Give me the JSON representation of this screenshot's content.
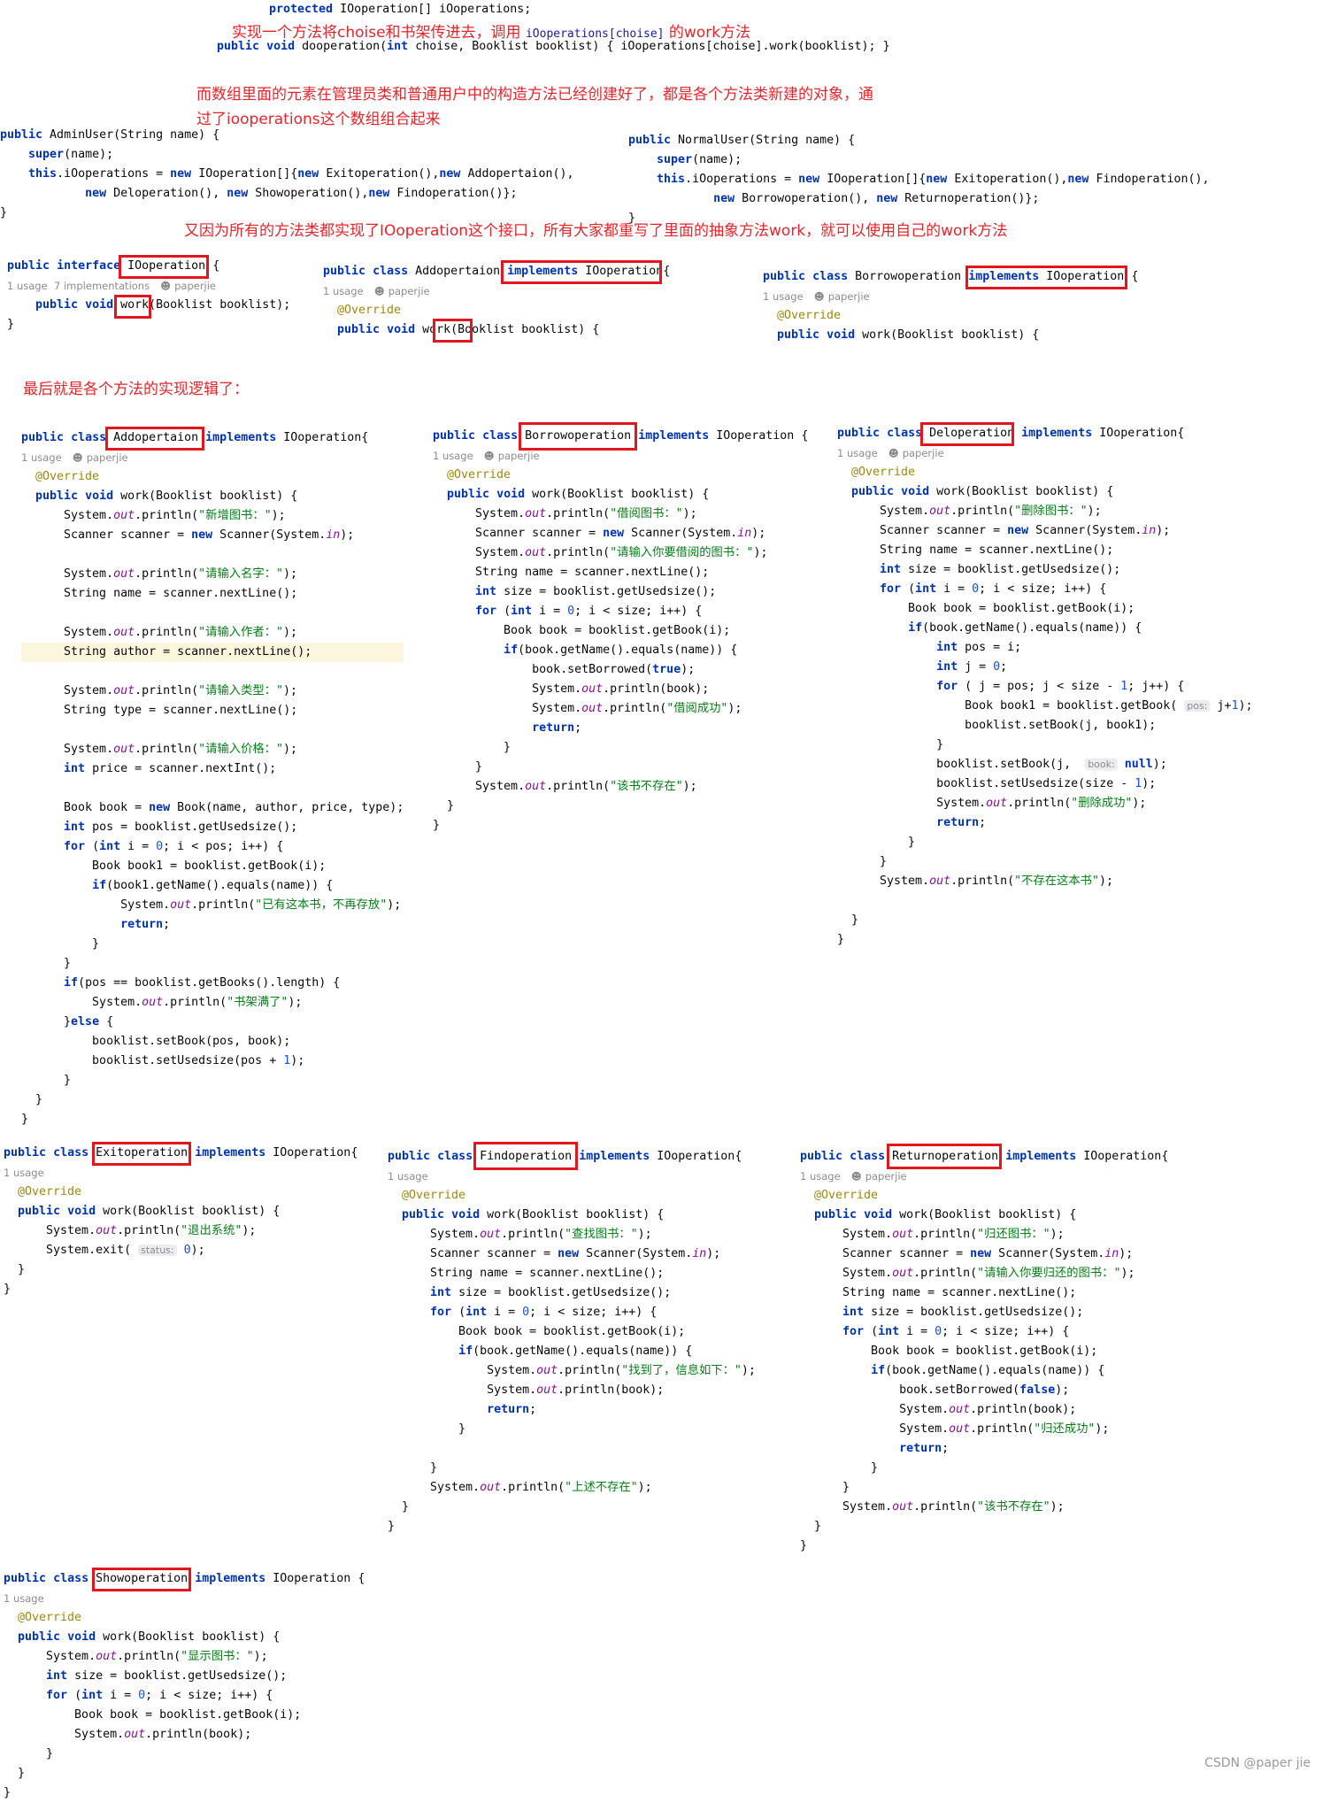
{
  "annotations": {
    "a1_pre": "实现一个方法将choise和书架传进去，调用 ",
    "a1_code": "iOoperations[choise]",
    "a1_post": " 的work方法",
    "a2_line1": "而数组里面的元素在管理员类和普通用户中的构造方法已经创建好了，都是各个方法类新建的对象，通",
    "a2_line2": "过了iooperations这个数组组合起来",
    "a3": "又因为所有的方法类都实现了IOoperation这个接口，所有大家都重写了里面的抽象方法work，就可以使用自己的work方法",
    "a4": "最后就是各个方法的实现逻辑了："
  },
  "hints": {
    "usage": "1 usage",
    "impls": "7 implementations",
    "author": "paperjie"
  },
  "param_hints": {
    "pos": "pos:",
    "book": "book:",
    "status": "status:"
  },
  "watermark": "CSDN @paper jie",
  "colors": {
    "annotation": "#e5242b",
    "highlight_box": "#e2161e",
    "keyword": "#0033b3",
    "string": "#067d17",
    "number": "#1750eb",
    "field": "#871094",
    "annotation_tag": "#9e880d"
  },
  "snippets": {
    "top_field": [
      "protected IOoperation[] iOoperations;"
    ],
    "top_method": [
      "public void dooperation(int choise, Booklist booklist) { iOoperations[choise].work(booklist); }"
    ],
    "admin": [
      "public AdminUser(String name) {",
      "    super(name);",
      "    this.iOoperations = new IOoperation[]{new Exitoperation(),new Addopertaion(),",
      "            new Deloperation(), new Showoperation(),new Findoperation()};",
      "}"
    ],
    "normal": [
      "public NormalUser(String name) {",
      "    super(name);",
      "    this.iOoperations = new IOoperation[]{new Exitoperation(),new Findoperation(),",
      "            new Borrowoperation(), new Returnoperation()};",
      "}"
    ],
    "iface": [
      "public interface IOoperation {",
      "  {{hint_impl}}",
      "    public void work(Booklist booklist);",
      "}"
    ],
    "addp_head": [
      "public class Addopertaion implements IOoperation{",
      "  {{hint}}",
      "  @Override",
      "  public void work(Booklist booklist) {"
    ],
    "borrow_head": [
      "public class Borrowoperation implements IOoperation {",
      "  {{hint}}",
      "  @Override",
      "  public void work(Booklist booklist) {"
    ],
    "add": [
      "public class Addopertaion implements IOoperation{",
      "  {{hint}}",
      "  @Override",
      "  public void work(Booklist booklist) {",
      "      System.out.println(\"新增图书：\");",
      "      Scanner scanner = new Scanner(System.in);",
      "",
      "      System.out.println(\"请输入名字：\");",
      "      String name = scanner.nextLine();",
      "",
      "      System.out.println(\"请输入作者：\");",
      "      String author = scanner.nextLine();",
      "",
      "      System.out.println(\"请输入类型：\");",
      "      String type = scanner.nextLine();",
      "",
      "      System.out.println(\"请输入价格：\");",
      "      int price = scanner.nextInt();",
      "",
      "      Book book = new Book(name, author, price, type);",
      "      int pos = booklist.getUsedsize();",
      "      for (int i = 0; i < pos; i++) {",
      "          Book book1 = booklist.getBook(i);",
      "          if(book1.getName().equals(name)) {",
      "              System.out.println(\"已有这本书，不再存放\");",
      "              return;",
      "          }",
      "      }",
      "      if(pos == booklist.getBooks().length) {",
      "          System.out.println(\"书架满了\");",
      "      }else {",
      "          booklist.setBook(pos, book);",
      "          booklist.setUsedsize(pos + 1);",
      "      }",
      "  }",
      "}"
    ],
    "borrow": [
      "public class Borrowoperation implements IOoperation {",
      "  {{hint}}",
      "  @Override",
      "  public void work(Booklist booklist) {",
      "      System.out.println(\"借阅图书：\");",
      "      Scanner scanner = new Scanner(System.in);",
      "      System.out.println(\"请输入你要借阅的图书：\");",
      "      String name = scanner.nextLine();",
      "      int size = booklist.getUsedsize();",
      "      for (int i = 0; i < size; i++) {",
      "          Book book = booklist.getBook(i);",
      "          if(book.getName().equals(name)) {",
      "              book.setBorrowed(true);",
      "              System.out.println(book);",
      "              System.out.println(\"借阅成功\");",
      "              return;",
      "          }",
      "      }",
      "      System.out.println(\"该书不存在\");",
      "  }",
      "}"
    ],
    "del": [
      "public class Deloperation implements IOoperation{",
      "  {{hint}}",
      "  @Override",
      "  public void work(Booklist booklist) {",
      "      System.out.println(\"删除图书：\");",
      "      Scanner scanner = new Scanner(System.in);",
      "      String name = scanner.nextLine();",
      "      int size = booklist.getUsedsize();",
      "      for (int i = 0; i < size; i++) {",
      "          Book book = booklist.getBook(i);",
      "          if(book.getName().equals(name)) {",
      "              int pos = i;",
      "              int j = 0;",
      "              for ( j = pos; j < size - 1; j++) {",
      "                  Book book1 = booklist.getBook( {{pos}} j+1);",
      "                  booklist.setBook(j, book1);",
      "              }",
      "              booklist.setBook(j,  {{book}} null);",
      "              booklist.setUsedsize(size - 1);",
      "              System.out.println(\"删除成功\");",
      "              return;",
      "          }",
      "      }",
      "      System.out.println(\"不存在这本书\");",
      "",
      "  }",
      "}"
    ],
    "exit": [
      "public class Exitoperation implements IOoperation{",
      "  {{usage_only}}",
      "  @Override",
      "  public void work(Booklist booklist) {",
      "      System.out.println(\"退出系统\");",
      "      System.exit( {{status}} 0);",
      "  }",
      "}"
    ],
    "find": [
      "public class Findoperation implements IOoperation{",
      "  {{usage_only}}",
      "  @Override",
      "  public void work(Booklist booklist) {",
      "      System.out.println(\"查找图书：\");",
      "      Scanner scanner = new Scanner(System.in);",
      "      String name = scanner.nextLine();",
      "      int size = booklist.getUsedsize();",
      "      for (int i = 0; i < size; i++) {",
      "          Book book = booklist.getBook(i);",
      "          if(book.getName().equals(name)) {",
      "              System.out.println(\"找到了，信息如下：\");",
      "              System.out.println(book);",
      "              return;",
      "          }",
      "",
      "      }",
      "      System.out.println(\"上述不存在\");",
      "  }",
      "}"
    ],
    "ret": [
      "public class Returnoperation implements IOoperation{",
      "  {{hint}}",
      "  @Override",
      "  public void work(Booklist booklist) {",
      "      System.out.println(\"归还图书：\");",
      "      Scanner scanner = new Scanner(System.in);",
      "      System.out.println(\"请输入你要归还的图书：\");",
      "      String name = scanner.nextLine();",
      "      int size = booklist.getUsedsize();",
      "      for (int i = 0; i < size; i++) {",
      "          Book book = booklist.getBook(i);",
      "          if(book.getName().equals(name)) {",
      "              book.setBorrowed(false);",
      "              System.out.println(book);",
      "              System.out.println(\"归还成功\");",
      "              return;",
      "          }",
      "      }",
      "      System.out.println(\"该书不存在\");",
      "  }",
      "}"
    ],
    "show": [
      "public class Showoperation implements IOoperation {",
      "  {{usage_only}}",
      "  @Override",
      "  public void work(Booklist booklist) {",
      "      System.out.println(\"显示图书：\");",
      "      int size = booklist.getUsedsize();",
      "      for (int i = 0; i < size; i++) {",
      "          Book book = booklist.getBook(i);",
      "          System.out.println(book);",
      "      }",
      "  }",
      "}"
    ]
  }
}
